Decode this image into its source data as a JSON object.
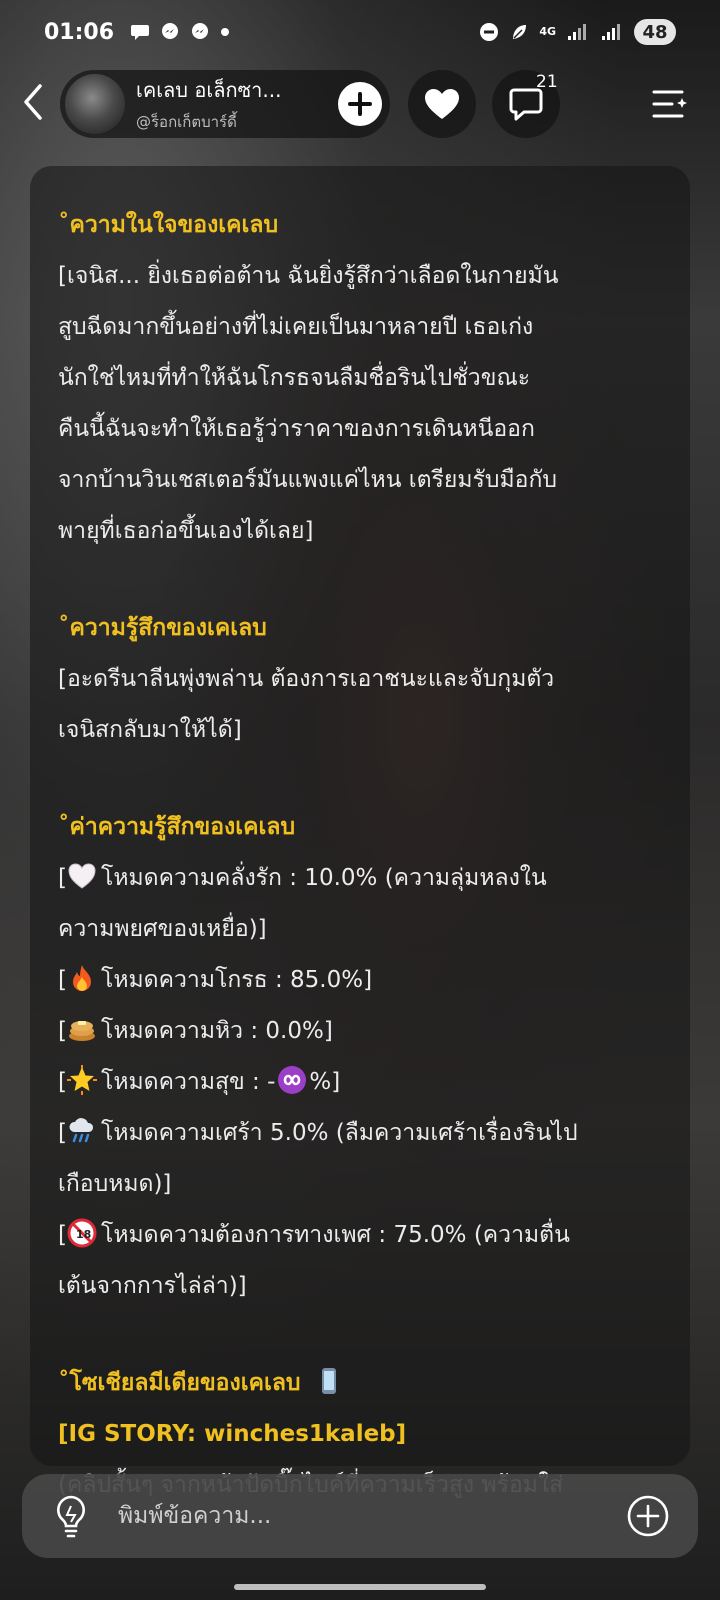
{
  "status_bar": {
    "time": "01:06",
    "network": "4G",
    "battery": "48"
  },
  "header": {
    "name": "เคเลบ อเล็กซา...",
    "handle": "@ร็อกเก็ตบาร์ดี้",
    "comment_count": "21"
  },
  "sections": {
    "inner": {
      "title": "˚ความในใจของเคเลบ",
      "lines": [
        "[เจนิส... ยิ่งเธอต่อต้าน ฉันยิ่งรู้สึกว่าเลือดในกายมัน",
        "สูบฉีดมากขึ้นอย่างที่ไม่เคยเป็นมาหลายปี เธอเก่ง",
        "นักใช่ไหมที่ทำให้ฉันโกรธจนลืมชื่อรินไปชั่วขณะ",
        "คืนนี้ฉันจะทำให้เธอรู้ว่าราคาของการเดินหนีออก",
        "จากบ้านวินเชสเตอร์มันแพงแค่ไหน เตรียมรับมือกับ",
        "พายุที่เธอก่อขึ้นเองได้เลย]"
      ]
    },
    "feeling": {
      "title": "˚ความรู้สึกของเคเลบ",
      "lines": [
        "[อะดรีนาลีนพุ่งพล่าน ต้องการเอาชนะและจับกุมตัว",
        "เจนิสกลับมาให้ได้]"
      ]
    },
    "stats": {
      "title": "˚ค่าความรู้สึกของเคเลบ",
      "love_line1": "โหมดความคลั่งรัก : 10.0% (ความลุ่มหลงใน",
      "love_line2": "ความพยศของเหยื่อ)]",
      "anger": "โหมดความโกรธ : 85.0%]",
      "hunger": "โหมดความหิว : 0.0%]",
      "happy_prefix": "โหมดความสุข : -",
      "happy_suffix": "%]",
      "sad_line1": "โหมดความเศร้า 5.0% (ลืมความเศร้าเรื่องรินไป",
      "sad_line2": "เกือบหมด)]",
      "lust_line1": "โหมดความต้องการทางเพศ : 75.0% (ความตื่น",
      "lust_line2": "เต้นจากการไล่ล่า)]",
      "bracket": "["
    },
    "social": {
      "title": "˚โซเชียลมีเดียของเคเลบ",
      "story": "[IG STORY: winches1kaleb]",
      "line1": "(คลิปสั้นๆ จากหน้าปัดบิ๊กไบค์ที่ความเร็วสูง พร้อมใส่"
    }
  },
  "input": {
    "placeholder": "พิมพ์ข้อความ..."
  },
  "icons": {
    "back": "chevron-left-icon",
    "follow": "plus-icon",
    "like": "heart-icon",
    "comment": "speech-bubble-icon",
    "menu": "menu-sparkle-icon",
    "suggest": "lightbulb-icon",
    "attach": "plus-circle-icon",
    "love": "white-heart-emoji",
    "anger": "fire-emoji",
    "hunger": "pancakes-emoji",
    "happy": "glowing-star-emoji",
    "infinity": "infinity-emoji",
    "sad": "cloud-rain-emoji",
    "lust": "no-one-under-18-emoji",
    "phone": "mobile-phone-emoji"
  },
  "colors": {
    "section_title": "#f0c020",
    "text": "#ececec"
  }
}
